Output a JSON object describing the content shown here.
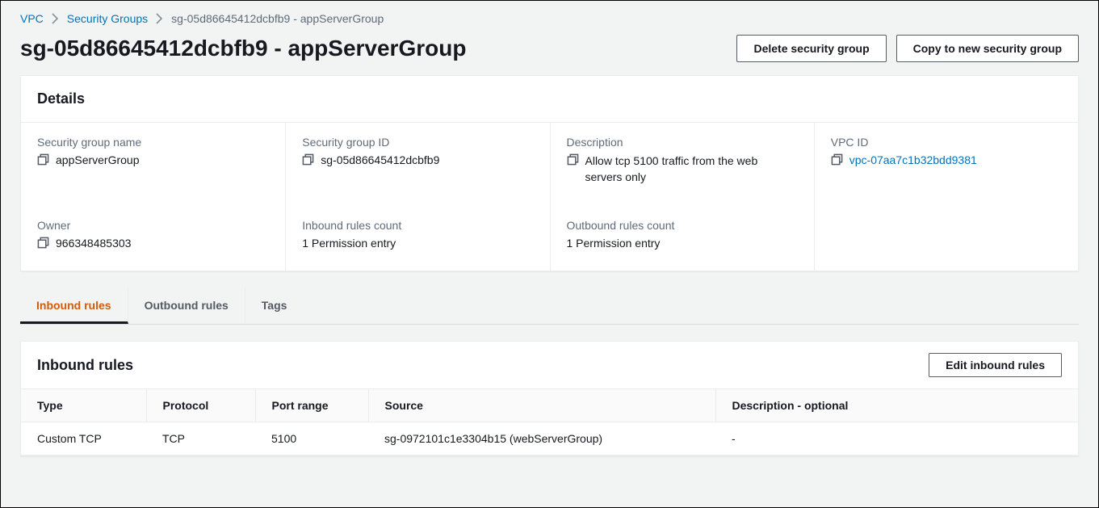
{
  "breadcrumbs": {
    "vpc": "VPC",
    "security_groups": "Security Groups",
    "current": "sg-05d86645412dcbfb9 - appServerGroup"
  },
  "header": {
    "title": "sg-05d86645412dcbfb9 - appServerGroup",
    "delete_label": "Delete security group",
    "copy_label": "Copy to new security group"
  },
  "details": {
    "title": "Details",
    "fields": {
      "name_label": "Security group name",
      "name_value": "appServerGroup",
      "id_label": "Security group ID",
      "id_value": "sg-05d86645412dcbfb9",
      "desc_label": "Description",
      "desc_value": "Allow tcp 5100 traffic from the web servers only",
      "vpc_label": "VPC ID",
      "vpc_value": "vpc-07aa7c1b32bdd9381",
      "owner_label": "Owner",
      "owner_value": "966348485303",
      "inbound_count_label": "Inbound rules count",
      "inbound_count_value": "1 Permission entry",
      "outbound_count_label": "Outbound rules count",
      "outbound_count_value": "1 Permission entry"
    }
  },
  "tabs": {
    "inbound": "Inbound rules",
    "outbound": "Outbound rules",
    "tags": "Tags"
  },
  "inbound_panel": {
    "title": "Inbound rules",
    "edit_label": "Edit inbound rules",
    "columns": {
      "type": "Type",
      "protocol": "Protocol",
      "port": "Port range",
      "source": "Source",
      "desc": "Description - optional"
    },
    "rows": [
      {
        "type": "Custom TCP",
        "protocol": "TCP",
        "port": "5100",
        "source": "sg-0972101c1e3304b15 (webServerGroup)",
        "desc": "-"
      }
    ]
  }
}
